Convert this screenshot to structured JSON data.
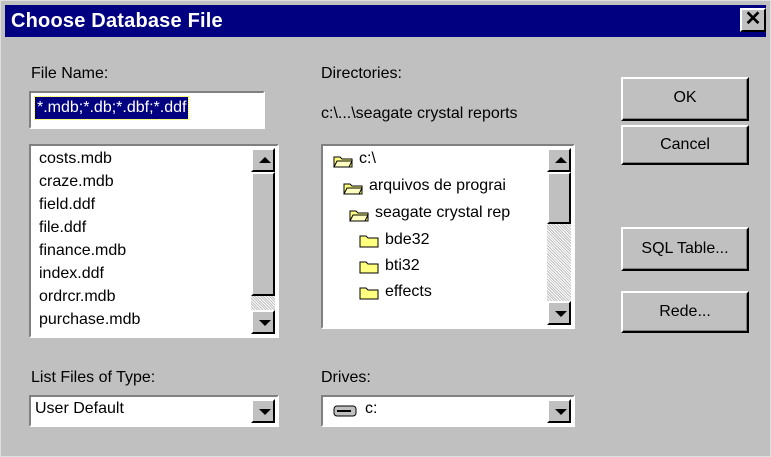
{
  "window": {
    "title": "Choose Database File",
    "close_glyph": "✕"
  },
  "file_name": {
    "label": "File Name:",
    "value": "*.mdb;*.db;*.dbf;*.ddf"
  },
  "files": [
    "costs.mdb",
    "craze.mdb",
    "field.ddf",
    "file.ddf",
    "finance.mdb",
    "index.ddf",
    "ordrcr.mdb",
    "purchase.mdb"
  ],
  "directories": {
    "label": "Directories:",
    "current_path": "c:\\...\\seagate crystal reports",
    "items": [
      {
        "label": "c:\\",
        "icon": "open-folder-icon"
      },
      {
        "label": "arquivos de prograi",
        "icon": "open-folder-icon"
      },
      {
        "label": "seagate crystal rep",
        "icon": "open-folder-icon"
      },
      {
        "label": "bde32",
        "icon": "folder-icon"
      },
      {
        "label": "bti32",
        "icon": "folder-icon"
      },
      {
        "label": "effects",
        "icon": "folder-icon"
      }
    ]
  },
  "file_type": {
    "label": "List Files of Type:",
    "value": "User Default"
  },
  "drives": {
    "label": "Drives:",
    "value": "c:",
    "icon": "drive-icon"
  },
  "buttons": {
    "ok": "OK",
    "cancel": "Cancel",
    "sql_table": "SQL Table...",
    "rede": "Rede..."
  },
  "colors": {
    "face": "#c0c0c0",
    "title_bar": "#000080",
    "selection": "#000080",
    "folder": "#ffff80"
  }
}
